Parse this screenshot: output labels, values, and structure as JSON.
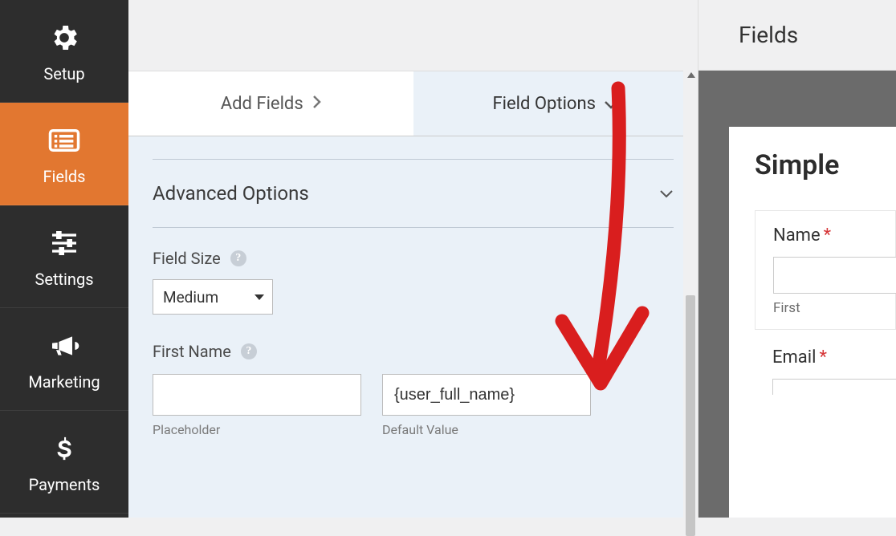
{
  "sidebar": {
    "items": [
      {
        "label": "Setup"
      },
      {
        "label": "Fields"
      },
      {
        "label": "Settings"
      },
      {
        "label": "Marketing"
      },
      {
        "label": "Payments"
      }
    ]
  },
  "tabs": {
    "add": "Add Fields",
    "options": "Field Options"
  },
  "panel": {
    "advanced": "Advanced Options",
    "field_size_label": "Field Size",
    "field_size_value": "Medium",
    "first_name_label": "First Name",
    "placeholder_sub": "Placeholder",
    "default_value_sub": "Default Value",
    "default_value_input": "{user_full_name}"
  },
  "right": {
    "header": "Fields",
    "preview_title": "Simple",
    "name_label": "Name",
    "first_sub": "First",
    "email_label": "Email"
  }
}
